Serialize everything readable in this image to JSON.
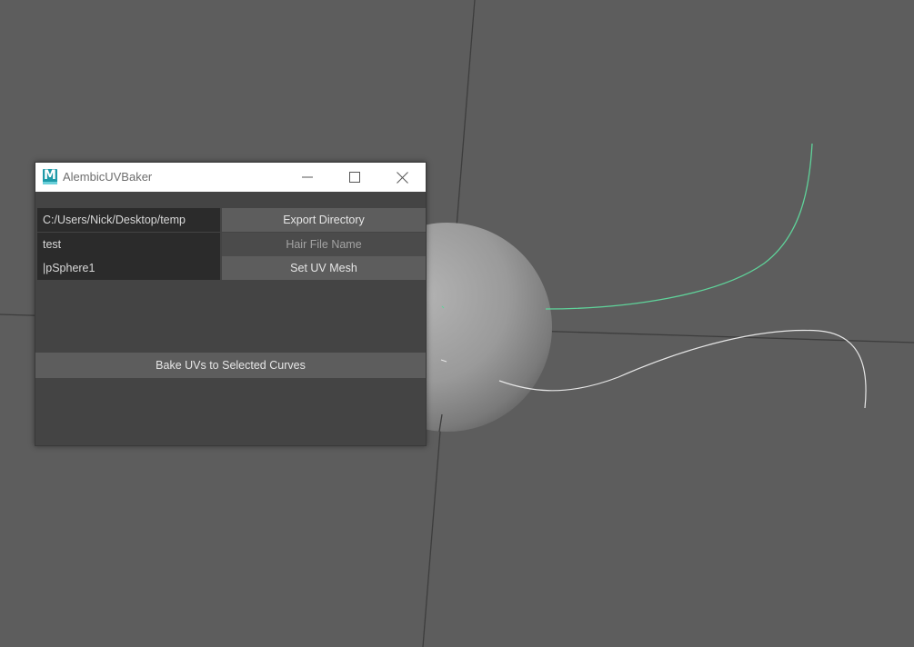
{
  "window": {
    "title": "AlembicUVBaker",
    "app_icon_letter": "M"
  },
  "rows": {
    "export": {
      "value": "C:/Users/Nick/Desktop/temp",
      "button": "Export Directory"
    },
    "hair": {
      "value": "test",
      "button": "Hair File Name"
    },
    "mesh": {
      "value": "|pSphere1",
      "button": "Set UV Mesh"
    }
  },
  "bake_button": "Bake UVs to Selected Curves",
  "colors": {
    "viewport_bg": "#5d5d5d",
    "panel_bg": "#444444",
    "field_bg": "#2b2b2b",
    "button_bg": "#5d5d5d",
    "curve_selected": "#5fd39a",
    "curve_unselected": "#e6e6e6",
    "app_icon": "#1d9aa8"
  }
}
